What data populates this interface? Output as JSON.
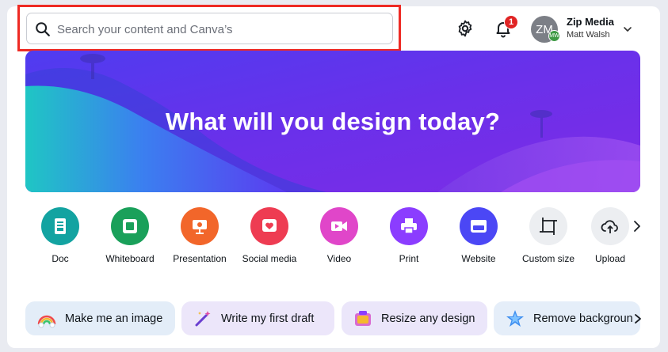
{
  "search": {
    "placeholder": "Search your content and Canva’s"
  },
  "header": {
    "notification_count": "1",
    "account": {
      "initials": "ZM",
      "badge": "MW",
      "name": "Zip Media",
      "user": "Matt Walsh"
    }
  },
  "hero": {
    "title": "What will you design today?"
  },
  "categories": [
    {
      "label": "Doc",
      "color": "#13a3a1",
      "icon": "doc-icon"
    },
    {
      "label": "Whiteboard",
      "color": "#1aa05a",
      "icon": "whiteboard-icon"
    },
    {
      "label": "Presentation",
      "color": "#f2662a",
      "icon": "presentation-icon"
    },
    {
      "label": "Social media",
      "color": "#ee3c52",
      "icon": "heart-icon"
    },
    {
      "label": "Video",
      "color": "#e046c9",
      "icon": "video-camera-icon"
    },
    {
      "label": "Print",
      "color": "#8b3dff",
      "icon": "printer-icon"
    },
    {
      "label": "Website",
      "color": "#4b47f5",
      "icon": "website-icon"
    },
    {
      "label": "Custom size",
      "color": "#eceef1",
      "icon": "crop-icon"
    },
    {
      "label": "Upload",
      "color": "#eceef1",
      "icon": "cloud-upload-icon"
    }
  ],
  "chips": [
    {
      "label": "Make me an image",
      "icon": "rainbow-icon"
    },
    {
      "label": "Write my first draft",
      "icon": "magic-wand-icon"
    },
    {
      "label": "Resize any design",
      "icon": "resize-icon"
    },
    {
      "label": "Remove backgroun",
      "icon": "star-icon"
    }
  ],
  "colors": {
    "accent_red": "#ee2a24",
    "hero_purple": "#6d2ee8",
    "hero_teal": "#1ec4c0"
  }
}
